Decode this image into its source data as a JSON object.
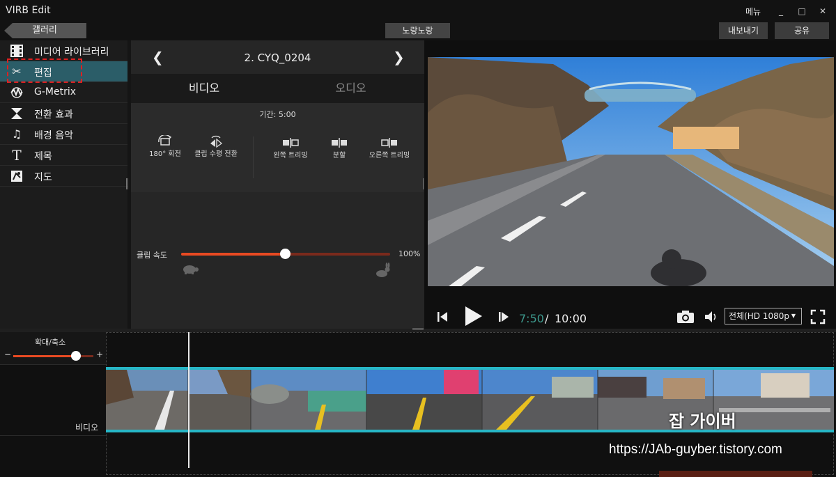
{
  "app": {
    "title": "VIRB Edit",
    "menu_label": "메뉴"
  },
  "window_buttons": {
    "minimize": "_",
    "maximize": "□",
    "close": "✕"
  },
  "toolbar": {
    "gallery_label": "갤러리",
    "project_name": "노랑노랑",
    "export_label": "내보내기",
    "share_label": "공유"
  },
  "sidebar": {
    "items": [
      {
        "label": "미디어 라이브러리",
        "icon": "film-icon"
      },
      {
        "label": "편집",
        "icon": "scissors-icon",
        "active": true
      },
      {
        "label": "G-Metrix",
        "icon": "gmetrix-icon"
      },
      {
        "label": "전환 효과",
        "icon": "transition-icon"
      },
      {
        "label": "배경 음악",
        "icon": "music-note-icon"
      },
      {
        "label": "제목",
        "icon": "text-icon"
      },
      {
        "label": "지도",
        "icon": "map-icon"
      }
    ]
  },
  "clip": {
    "prev_icon": "❮",
    "next_icon": "❯",
    "title": "2. CYQ_0204"
  },
  "tabs": {
    "video": "비디오",
    "audio": "오디오"
  },
  "tools": {
    "duration": "기간: 5:00",
    "rotate": "180° 회전",
    "flip": "클립 수평 전환",
    "trim_left": "왼쪽 트리밍",
    "split": "분할",
    "trim_right": "오른쪽 트리밍"
  },
  "speed": {
    "label": "클립 속도",
    "value": "100%",
    "level_fraction": 0.5
  },
  "player": {
    "time_current": "7:50",
    "time_sep": "/",
    "time_total": "10:00",
    "quality": "전체(HD 1080p",
    "progress_fraction": 0.783
  },
  "timeline": {
    "zoom_label": "확대/축소",
    "zoom_minus": "−",
    "zoom_plus": "+",
    "zoom_fraction": 0.78,
    "track_label": "비디오"
  },
  "watermark": {
    "name": "잡 가이버",
    "url": "https://JAb-guyber.tistory.com"
  },
  "colors": {
    "accent": "#e84a22",
    "active_sidebar": "#2b5d68",
    "track_border": "#27b6c6",
    "time_current": "#3d9a8e"
  }
}
